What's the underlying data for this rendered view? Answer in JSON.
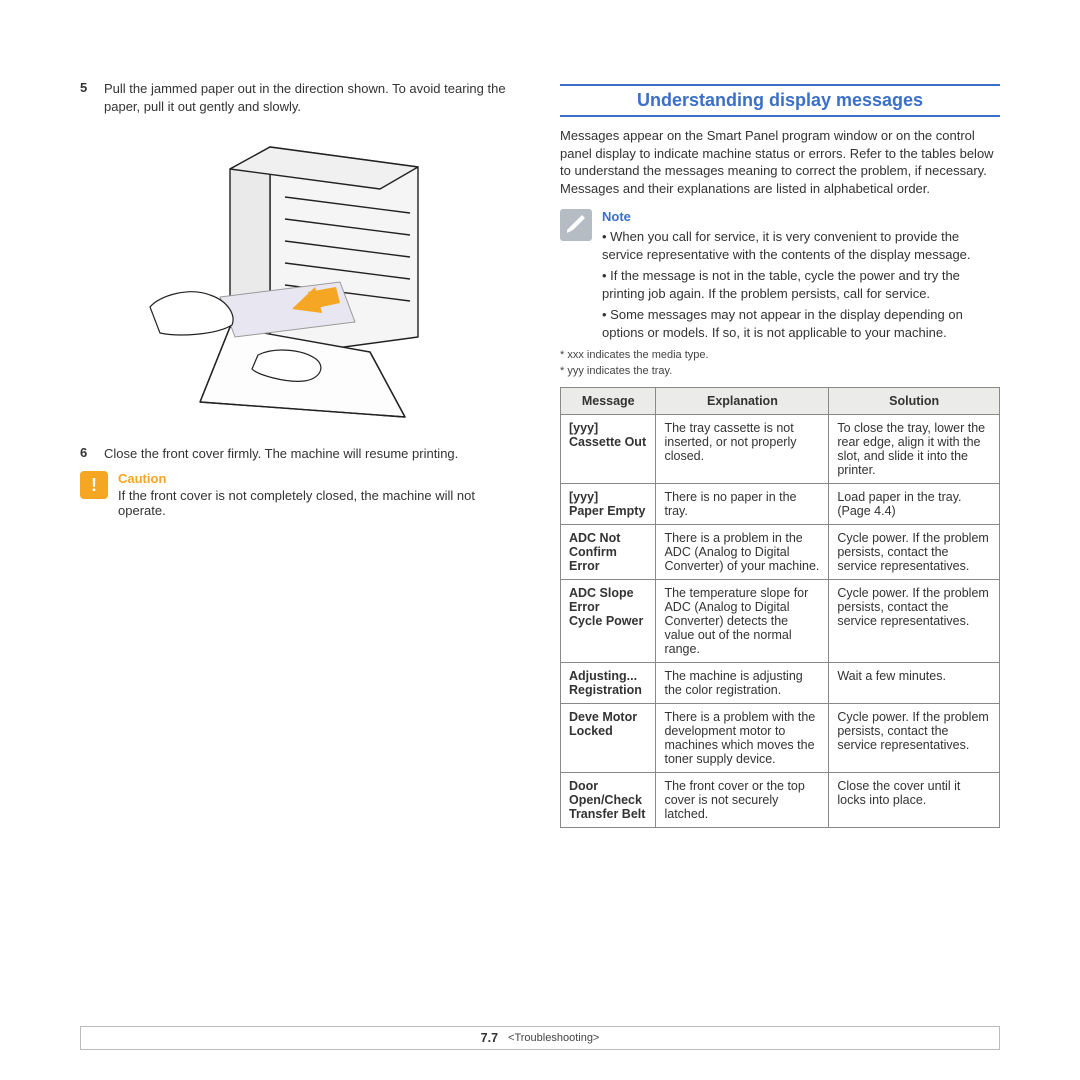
{
  "leftColumn": {
    "step5": {
      "num": "5",
      "text": "Pull the jammed paper out in the direction shown. To avoid tearing the paper, pull it out gently and slowly."
    },
    "step6": {
      "num": "6",
      "text": "Close the front cover firmly. The machine will resume printing."
    },
    "caution": {
      "title": "Caution",
      "text": "If the front cover is not completely closed, the machine will not operate."
    }
  },
  "rightColumn": {
    "heading": "Understanding display messages",
    "intro": "Messages appear on the Smart Panel program window or on the control panel display to indicate machine status or errors. Refer to the tables below to understand the messages meaning to correct the problem, if necessary. Messages and their explanations are listed in alphabetical order.",
    "note": {
      "title": "Note",
      "items": [
        "• When you call for service, it is very convenient to provide the service representative with the contents of the display message.",
        "• If the message is not in the table, cycle the power and try the printing job again. If the problem persists, call for service.",
        "• Some messages may not appear in the display depending on options or models. If so, it is not applicable to your machine."
      ]
    },
    "smallNote1": "* xxx indicates the media type.",
    "smallNote2": "* yyy indicates the tray.",
    "table": {
      "headers": [
        "Message",
        "Explanation",
        "Solution"
      ],
      "rows": [
        [
          "[yyy]\nCassette Out",
          "The tray cassette is not inserted, or not properly closed.",
          "To close the tray, lower the rear edge, align it with the slot, and slide it into the printer."
        ],
        [
          "[yyy]\nPaper Empty",
          "There is no paper in the tray.",
          "Load paper in the tray. (Page 4.4)"
        ],
        [
          "ADC Not\nConfirm Error",
          "There is a problem in the ADC (Analog to Digital Converter) of your machine.",
          "Cycle power. If the problem persists, contact the service representatives."
        ],
        [
          "ADC Slope Error\nCycle Power",
          "The temperature slope for ADC (Analog to Digital Converter) detects the value out of the normal range.",
          "Cycle power. If the problem persists, contact the service representatives."
        ],
        [
          "Adjusting...\nRegistration",
          "The machine is adjusting the color registration.",
          "Wait a few minutes."
        ],
        [
          "Deve Motor\nLocked",
          "There is a problem with the development motor to machines which moves the toner supply device.",
          "Cycle power. If the problem persists, contact the service representatives."
        ],
        [
          "Door Open/Check\nTransfer Belt",
          "The front cover or the top cover is not securely latched.",
          "Close the cover until it locks into place."
        ]
      ]
    }
  },
  "footer": {
    "pagePrefix": "7",
    "pageNum": ".7",
    "chapter": "<Troubleshooting>"
  }
}
